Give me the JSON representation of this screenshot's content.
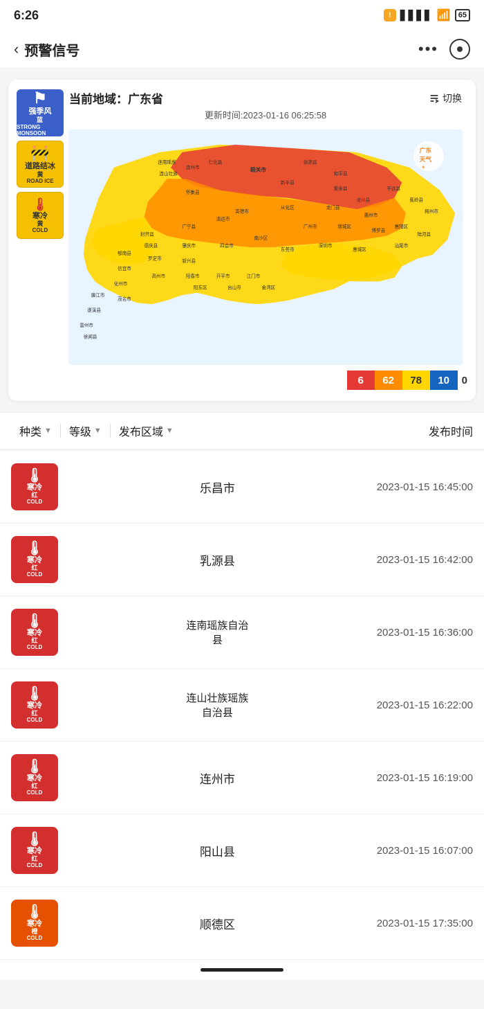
{
  "statusBar": {
    "time": "6:26",
    "battery": "65"
  },
  "header": {
    "title": "预警信号",
    "backLabel": "‹",
    "moreLabel": "•••"
  },
  "map": {
    "currentRegion": "当前地域：广东省",
    "updateTime": "更新时间:2023-01-16 06:25:58",
    "switchLabel": "切换",
    "logoLabel": "广东天气",
    "counts": {
      "red": "6",
      "orange": "62",
      "yellow": "78",
      "blue": "10",
      "zero": "0"
    }
  },
  "filters": {
    "type": "种类",
    "level": "等级",
    "area": "发布区域",
    "time": "发布时间"
  },
  "warnings": [
    {
      "area": "乐昌市",
      "time": "2023-01-15 16:45:00",
      "level": "红",
      "type": "寒冷",
      "color": "red"
    },
    {
      "area": "乳源县",
      "time": "2023-01-15 16:42:00",
      "level": "红",
      "type": "寒冷",
      "color": "red"
    },
    {
      "area": "连南瑶族自治县",
      "time": "2023-01-15 16:36:00",
      "level": "红",
      "type": "寒冷",
      "color": "red"
    },
    {
      "area": "连山壮族瑶族自治县",
      "time": "2023-01-15 16:22:00",
      "level": "红",
      "type": "寒冷",
      "color": "red"
    },
    {
      "area": "连州市",
      "time": "2023-01-15 16:19:00",
      "level": "红",
      "type": "寒冷",
      "color": "red"
    },
    {
      "area": "阳山县",
      "time": "2023-01-15 16:07:00",
      "level": "红",
      "type": "寒冷",
      "color": "red"
    },
    {
      "area": "顺德区",
      "time": "2023-01-15 17:35:00",
      "level": "橙",
      "type": "寒冷",
      "color": "orange"
    }
  ]
}
